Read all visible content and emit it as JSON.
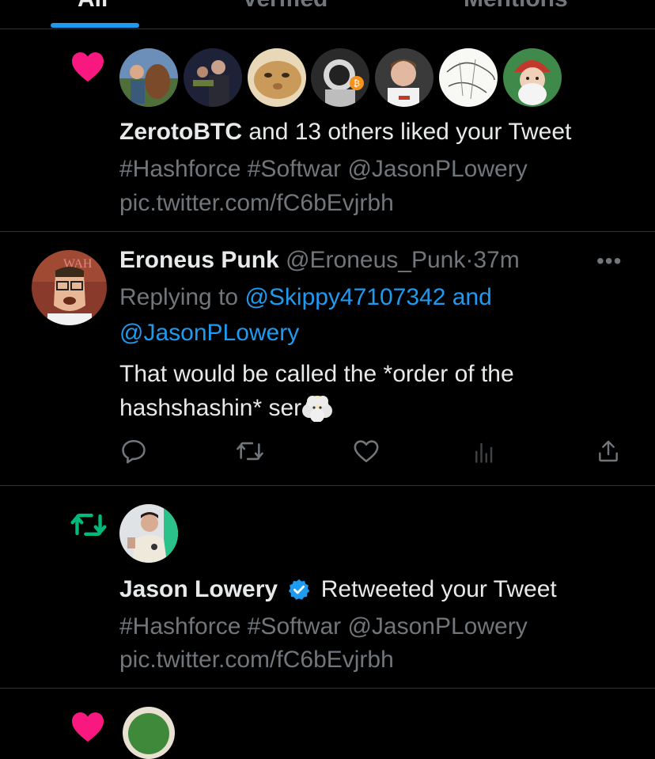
{
  "tabs": [
    "All",
    "Verified",
    "Mentions"
  ],
  "colors": {
    "accent": "#1d9bf0",
    "like": "#f91880",
    "retweet": "#00ba7c",
    "muted": "#71767b"
  },
  "like_notification": {
    "icon": "heart-icon",
    "actor": "ZerotoBTC",
    "rest": "and 13 others liked your Tweet",
    "tweet_line1": "#Hashforce #Softwar @JasonPLowery",
    "tweet_line2": "pic.twitter.com/fC6bEvjrbh"
  },
  "reply": {
    "name": "Eroneus Punk",
    "handle": "@Eroneus_Punk",
    "sep": "·",
    "time": "37m",
    "more": "•••",
    "replying_prefix": "Replying to",
    "replying_to_line1": "@Skippy47107342 and",
    "replying_to_line2": "@JasonPLowery",
    "body_line1": "That would be called the *order of the",
    "body_line2": "hashshashin* ser",
    "emoji": "face-in-clouds"
  },
  "retweet_notification": {
    "icon": "retweet-icon",
    "name": "Jason Lowery",
    "rest": "Retweeted your Tweet",
    "tweet_line1": "#Hashforce #Softwar @JasonPLowery",
    "tweet_line2": "pic.twitter.com/fC6bEvjrbh"
  }
}
